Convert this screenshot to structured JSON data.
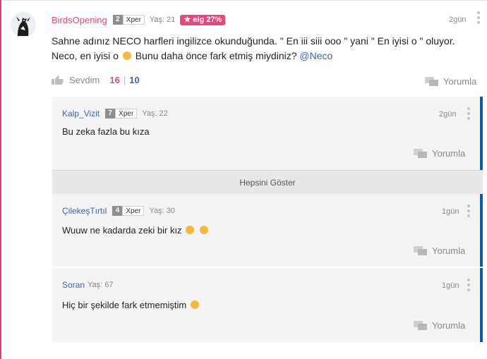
{
  "post": {
    "username": "BirdsOpening",
    "level": "2",
    "xper": "Xper",
    "age": "Yaş: 21",
    "badge": "eig 27%",
    "time": "2gün",
    "text_main": "Sahne adınız NECO harfleri ingilizce okunduğunda. \" En iii siii ooo \" yani \" En iyisi o \" oluyor. Neco, en iyisi o",
    "text_tail": "Bunu daha önce fark etmiş miydiniz?",
    "mention": "@Neco",
    "like_label": "Sevdim",
    "like_count": "16",
    "like_separator": "|",
    "dislike_count": "10",
    "reply_label": "Yorumla",
    "accent_color": "#d44a82"
  },
  "comments": [
    {
      "username": "Kalp_Vizit",
      "level": "7",
      "xper": "Xper",
      "age": "Yaş: 22",
      "time": "2gün",
      "text": "Bu zeka fazla bu kıza",
      "reply_label": "Yorumla"
    },
    {
      "username": "ÇilekeşTırtıl",
      "level": "4",
      "xper": "Xper",
      "age": "Yaş: 30",
      "time": "1gün",
      "text": "Wuuw ne kadarda zeki bir kız",
      "reply_label": "Yorumla"
    },
    {
      "username": "Soran",
      "age": "Yaş: 67",
      "time": "1gün",
      "text": "Hiç bir şekilde fark etmemiştim",
      "reply_label": "Yorumla"
    }
  ],
  "show_all_label": "Hepsini Göster",
  "thread_accent_color": "#0f5aa5"
}
